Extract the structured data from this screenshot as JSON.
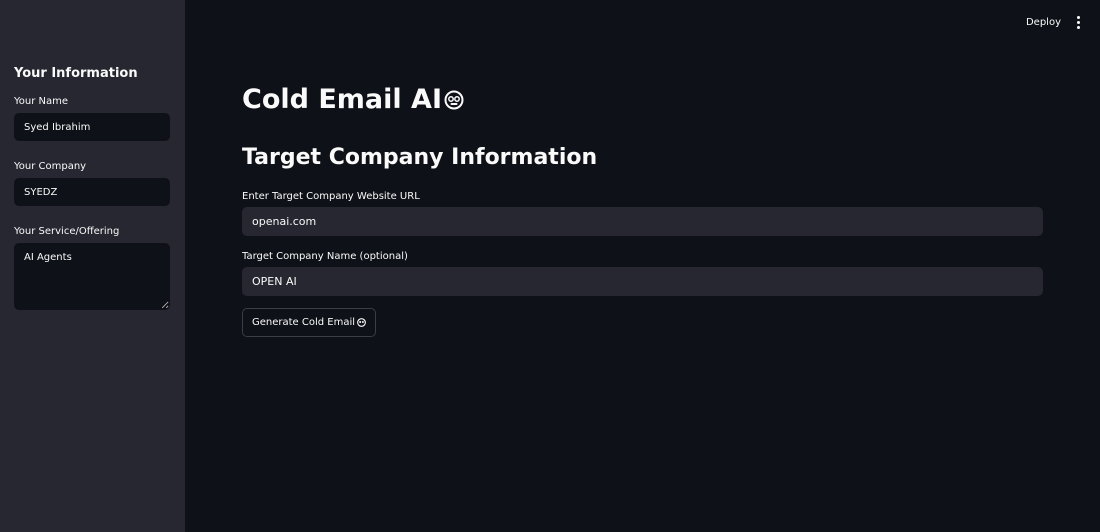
{
  "sidebar": {
    "title": "Your Information",
    "name_label": "Your Name",
    "name_value": "Syed Ibrahim",
    "company_label": "Your Company",
    "company_value": "SYEDZ",
    "service_label": "Your Service/Offering",
    "service_value": "AI Agents"
  },
  "header": {
    "deploy_label": "Deploy",
    "menu_icon": "vertical-ellipsis-icon"
  },
  "main": {
    "title": "Cold Email AI",
    "title_icon": "robot-icon",
    "section_title": "Target Company Information",
    "url_label": "Enter Target Company Website URL",
    "url_value": "openai.com",
    "company_name_label": "Target Company Name (optional)",
    "company_name_value": "OPEN AI",
    "generate_label": "Generate Cold Email",
    "generate_icon": "robot-icon"
  },
  "colors": {
    "background": "#0e1117",
    "sidebar": "#262730",
    "input": "#262730",
    "text": "#fafafa"
  }
}
